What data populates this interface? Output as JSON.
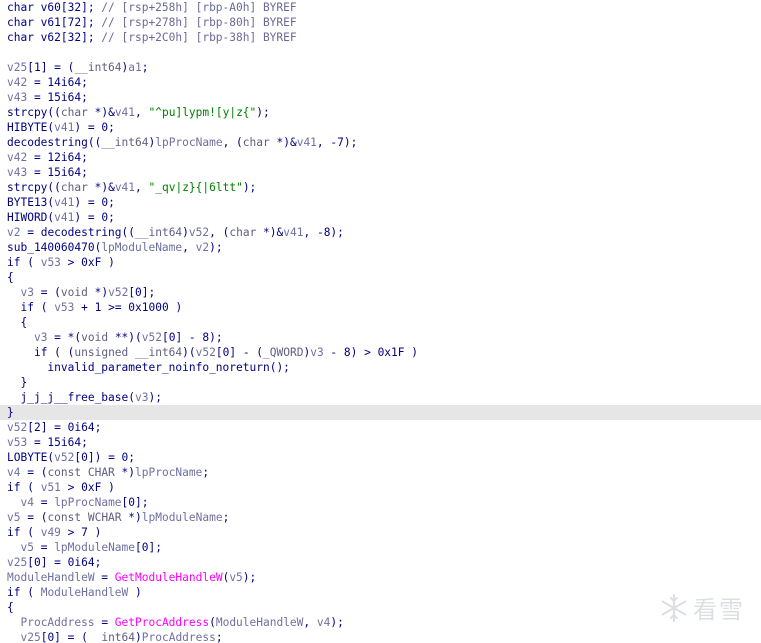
{
  "code_view": {
    "lines": [
      [
        [
          "plain",
          "char v60[32]; "
        ],
        [
          "cmt",
          "// [rsp+258h] [rbp-A0h] BYREF"
        ]
      ],
      [
        [
          "plain",
          "char v61[72]; "
        ],
        [
          "cmt",
          "// [rsp+278h] [rbp-80h] BYREF"
        ]
      ],
      [
        [
          "plain",
          "char v62[32]; "
        ],
        [
          "cmt",
          "// [rsp+2C0h] [rbp-38h] BYREF"
        ]
      ],
      [],
      [
        [
          "var",
          "v25"
        ],
        [
          "plain",
          "[1] = ("
        ],
        [
          "type",
          "__int64"
        ],
        [
          "plain",
          ")"
        ],
        [
          "var",
          "a1"
        ],
        [
          "plain",
          ";"
        ]
      ],
      [
        [
          "var",
          "v42"
        ],
        [
          "plain",
          " = 14i64;"
        ]
      ],
      [
        [
          "var",
          "v43"
        ],
        [
          "plain",
          " = 15i64;"
        ]
      ],
      [
        [
          "func",
          "strcpy"
        ],
        [
          "plain",
          "(("
        ],
        [
          "type",
          "char"
        ],
        [
          "plain",
          " *)&"
        ],
        [
          "var",
          "v41"
        ],
        [
          "plain",
          ", "
        ],
        [
          "str",
          "\"^pu]lypm![y|z{\""
        ],
        [
          "plain",
          ");"
        ]
      ],
      [
        [
          "func",
          "HIBYTE"
        ],
        [
          "plain",
          "("
        ],
        [
          "var",
          "v41"
        ],
        [
          "plain",
          ") = 0;"
        ]
      ],
      [
        [
          "func",
          "decodestring"
        ],
        [
          "plain",
          "(("
        ],
        [
          "type",
          "__int64"
        ],
        [
          "plain",
          ")"
        ],
        [
          "var",
          "lpProcName"
        ],
        [
          "plain",
          ", ("
        ],
        [
          "type",
          "char"
        ],
        [
          "plain",
          " *)&"
        ],
        [
          "var",
          "v41"
        ],
        [
          "plain",
          ", -7);"
        ]
      ],
      [
        [
          "var",
          "v42"
        ],
        [
          "plain",
          " = 12i64;"
        ]
      ],
      [
        [
          "var",
          "v43"
        ],
        [
          "plain",
          " = 15i64;"
        ]
      ],
      [
        [
          "func",
          "strcpy"
        ],
        [
          "plain",
          "(("
        ],
        [
          "type",
          "char"
        ],
        [
          "plain",
          " *)&"
        ],
        [
          "var",
          "v41"
        ],
        [
          "plain",
          ", "
        ],
        [
          "str",
          "\"_qv|z}{|6ltt\""
        ],
        [
          "plain",
          ");"
        ]
      ],
      [
        [
          "func",
          "BYTE13"
        ],
        [
          "plain",
          "("
        ],
        [
          "var",
          "v41"
        ],
        [
          "plain",
          ") = 0;"
        ]
      ],
      [
        [
          "func",
          "HIWORD"
        ],
        [
          "plain",
          "("
        ],
        [
          "var",
          "v41"
        ],
        [
          "plain",
          ") = 0;"
        ]
      ],
      [
        [
          "var",
          "v2"
        ],
        [
          "plain",
          " = "
        ],
        [
          "func",
          "decodestring"
        ],
        [
          "plain",
          "(("
        ],
        [
          "type",
          "__int64"
        ],
        [
          "plain",
          ")"
        ],
        [
          "var",
          "v52"
        ],
        [
          "plain",
          ", ("
        ],
        [
          "type",
          "char"
        ],
        [
          "plain",
          " *)&"
        ],
        [
          "var",
          "v41"
        ],
        [
          "plain",
          ", -8);"
        ]
      ],
      [
        [
          "func",
          "sub_140060470"
        ],
        [
          "plain",
          "("
        ],
        [
          "var",
          "lpModuleName"
        ],
        [
          "plain",
          ", "
        ],
        [
          "var",
          "v2"
        ],
        [
          "plain",
          ");"
        ]
      ],
      [
        [
          "kw",
          "if"
        ],
        [
          "plain",
          " ( "
        ],
        [
          "var",
          "v53"
        ],
        [
          "plain",
          " > 0xF )"
        ]
      ],
      [
        [
          "plain",
          "{"
        ]
      ],
      [
        [
          "plain",
          "  "
        ],
        [
          "var",
          "v3"
        ],
        [
          "plain",
          " = ("
        ],
        [
          "type",
          "void"
        ],
        [
          "plain",
          " *)"
        ],
        [
          "var",
          "v52"
        ],
        [
          "plain",
          "[0];"
        ]
      ],
      [
        [
          "plain",
          "  "
        ],
        [
          "kw",
          "if"
        ],
        [
          "plain",
          " ( "
        ],
        [
          "var",
          "v53"
        ],
        [
          "plain",
          " + 1 >= 0x1000 )"
        ]
      ],
      [
        [
          "plain",
          "  {"
        ]
      ],
      [
        [
          "plain",
          "    "
        ],
        [
          "var",
          "v3"
        ],
        [
          "plain",
          " = *("
        ],
        [
          "type",
          "void"
        ],
        [
          "plain",
          " **)("
        ],
        [
          "var",
          "v52"
        ],
        [
          "plain",
          "[0] - 8);"
        ]
      ],
      [
        [
          "plain",
          "    "
        ],
        [
          "kw",
          "if"
        ],
        [
          "plain",
          " ( ("
        ],
        [
          "type",
          "unsigned __int64"
        ],
        [
          "plain",
          ")("
        ],
        [
          "var",
          "v52"
        ],
        [
          "plain",
          "[0] - ("
        ],
        [
          "type",
          "_QWORD"
        ],
        [
          "plain",
          ")"
        ],
        [
          "var",
          "v3"
        ],
        [
          "plain",
          " - 8) > 0x1F )"
        ]
      ],
      [
        [
          "plain",
          "      "
        ],
        [
          "func",
          "invalid_parameter_noinfo_noreturn"
        ],
        [
          "plain",
          "();"
        ]
      ],
      [
        [
          "plain",
          "  }"
        ]
      ],
      [
        [
          "plain",
          "  "
        ],
        [
          "func",
          "j_j_j__free_base"
        ],
        [
          "plain",
          "("
        ],
        [
          "var",
          "v3"
        ],
        [
          "plain",
          ");"
        ]
      ],
      [
        [
          "plain",
          "}"
        ]
      ],
      [
        [
          "var",
          "v52"
        ],
        [
          "plain",
          "[2] = 0i64;"
        ]
      ],
      [
        [
          "var",
          "v53"
        ],
        [
          "plain",
          " = 15i64;"
        ]
      ],
      [
        [
          "func",
          "LOBYTE"
        ],
        [
          "plain",
          "("
        ],
        [
          "var",
          "v52"
        ],
        [
          "plain",
          "[0]) = 0;"
        ]
      ],
      [
        [
          "var",
          "v4"
        ],
        [
          "plain",
          " = ("
        ],
        [
          "type",
          "const CHAR"
        ],
        [
          "plain",
          " *)"
        ],
        [
          "var",
          "lpProcName"
        ],
        [
          "plain",
          ";"
        ]
      ],
      [
        [
          "kw",
          "if"
        ],
        [
          "plain",
          " ( "
        ],
        [
          "var",
          "v51"
        ],
        [
          "plain",
          " > 0xF )"
        ]
      ],
      [
        [
          "plain",
          "  "
        ],
        [
          "var",
          "v4"
        ],
        [
          "plain",
          " = "
        ],
        [
          "var",
          "lpProcName"
        ],
        [
          "plain",
          "[0];"
        ]
      ],
      [
        [
          "var",
          "v5"
        ],
        [
          "plain",
          " = ("
        ],
        [
          "type",
          "const WCHAR"
        ],
        [
          "plain",
          " *)"
        ],
        [
          "var",
          "lpModuleName"
        ],
        [
          "plain",
          ";"
        ]
      ],
      [
        [
          "kw",
          "if"
        ],
        [
          "plain",
          " ( "
        ],
        [
          "var",
          "v49"
        ],
        [
          "plain",
          " > 7 )"
        ]
      ],
      [
        [
          "plain",
          "  "
        ],
        [
          "var",
          "v5"
        ],
        [
          "plain",
          " = "
        ],
        [
          "var",
          "lpModuleName"
        ],
        [
          "plain",
          "[0];"
        ]
      ],
      [
        [
          "var",
          "v25"
        ],
        [
          "plain",
          "[0] = 0i64;"
        ]
      ],
      [
        [
          "var",
          "ModuleHandleW"
        ],
        [
          "plain",
          " = "
        ],
        [
          "api",
          "GetModuleHandleW"
        ],
        [
          "plain",
          "("
        ],
        [
          "var",
          "v5"
        ],
        [
          "plain",
          ");"
        ]
      ],
      [
        [
          "kw",
          "if"
        ],
        [
          "plain",
          " ( "
        ],
        [
          "var",
          "ModuleHandleW"
        ],
        [
          "plain",
          " )"
        ]
      ],
      [
        [
          "plain",
          "{"
        ]
      ],
      [
        [
          "plain",
          "  "
        ],
        [
          "var",
          "ProcAddress"
        ],
        [
          "plain",
          " = "
        ],
        [
          "api",
          "GetProcAddress"
        ],
        [
          "plain",
          "("
        ],
        [
          "var",
          "ModuleHandleW"
        ],
        [
          "plain",
          ", "
        ],
        [
          "var",
          "v4"
        ],
        [
          "plain",
          ");"
        ]
      ],
      [
        [
          "plain",
          "  "
        ],
        [
          "var",
          "v25"
        ],
        [
          "plain",
          "[0] = ("
        ],
        [
          "type",
          "__int64"
        ],
        [
          "plain",
          ")"
        ],
        [
          "var",
          "ProcAddress"
        ],
        [
          "plain",
          ";"
        ]
      ]
    ],
    "highlighted_line": 27,
    "colors": {
      "highlight": "#e6e6e6",
      "string": "#008000",
      "api": "#ff00ff",
      "identifier": "#000080",
      "variable": "#7070a0"
    }
  },
  "watermark": {
    "text": "看雪",
    "icon": "snowflake-logo-icon"
  }
}
